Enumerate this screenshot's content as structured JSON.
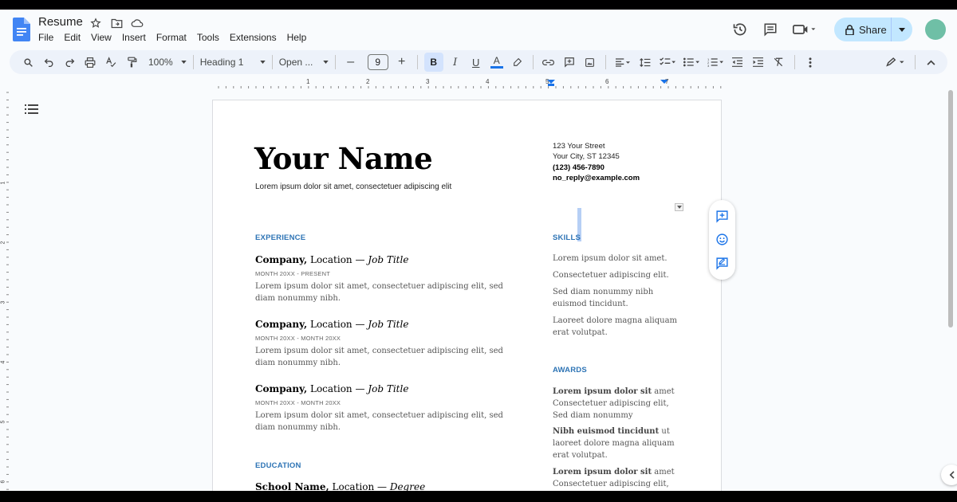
{
  "header": {
    "doc_title": "Resume",
    "menu": [
      "File",
      "Edit",
      "View",
      "Insert",
      "Format",
      "Tools",
      "Extensions",
      "Help"
    ],
    "share_label": "Share",
    "colors": {
      "share_bg": "#c2e7ff",
      "avatar": "#6fbfa6",
      "docs_blue": "#4285f4"
    }
  },
  "toolbar": {
    "zoom": "100%",
    "style": "Heading 1",
    "font": "Open ...",
    "font_size": "9",
    "icons": [
      "search-icon",
      "undo-icon",
      "redo-icon",
      "print-icon",
      "spellcheck-icon",
      "paint-format-icon",
      "bold-icon",
      "italic-icon",
      "underline-icon",
      "text-color-icon",
      "highlight-icon",
      "link-icon",
      "comment-icon",
      "image-icon",
      "align-icon",
      "line-spacing-icon",
      "checklist-icon",
      "bullet-list-icon",
      "numbered-list-icon",
      "decrease-indent-icon",
      "increase-indent-icon",
      "clear-format-icon",
      "more-icon",
      "edit-mode-icon",
      "collapse-icon"
    ]
  },
  "ruler": {
    "numbers": [
      "1",
      "2",
      "3",
      "4",
      "5",
      "6",
      "7"
    ],
    "vnumbers": [
      "1",
      "2",
      "3",
      "4",
      "5",
      "6"
    ]
  },
  "document": {
    "name": "Your Name",
    "tagline": "Lorem ipsum dolor sit amet, consectetuer adipiscing elit",
    "address": {
      "street": "123 Your Street",
      "city": "Your City, ST 12345",
      "phone": "(123) 456-7890",
      "email": "no_reply@example.com"
    },
    "experience_heading": "EXPERIENCE",
    "jobs": [
      {
        "company": "Company,",
        "location": " Location — ",
        "title": "Job Title",
        "dates": "MONTH 20XX - PRESENT",
        "desc": "Lorem ipsum dolor sit amet, consectetuer adipiscing elit, sed diam nonummy nibh."
      },
      {
        "company": "Company,",
        "location": " Location — ",
        "title": "Job Title",
        "dates": "MONTH 20XX - MONTH 20XX",
        "desc": "Lorem ipsum dolor sit amet, consectetuer adipiscing elit, sed diam nonummy nibh."
      },
      {
        "company": "Company,",
        "location": " Location — ",
        "title": "Job Title",
        "dates": "MONTH 20XX - MONTH 20XX",
        "desc": "Lorem ipsum dolor sit amet, consectetuer adipiscing elit, sed diam nonummy nibh."
      }
    ],
    "education_heading": "EDUCATION",
    "school": {
      "name": "School Name,",
      "location": " Location — ",
      "degree": "Degree"
    },
    "skills_heading": "SKILLS",
    "skills": [
      "Lorem ipsum dolor sit amet.",
      "Consectetuer adipiscing elit.",
      "Sed diam nonummy nibh euismod tincidunt.",
      "Laoreet dolore magna aliquam erat volutpat."
    ],
    "awards_heading": "AWARDS",
    "awards": [
      {
        "bold": "Lorem ipsum dolor sit",
        "rest": " amet Consectetuer adipiscing elit, Sed diam nonummy"
      },
      {
        "bold": "Nibh euismod tincidunt",
        "rest": " ut laoreet dolore magna aliquam erat volutpat."
      },
      {
        "bold": "Lorem ipsum dolor sit",
        "rest": " amet Consectetuer adipiscing elit,"
      }
    ],
    "accent_color": "#2e74b5"
  }
}
